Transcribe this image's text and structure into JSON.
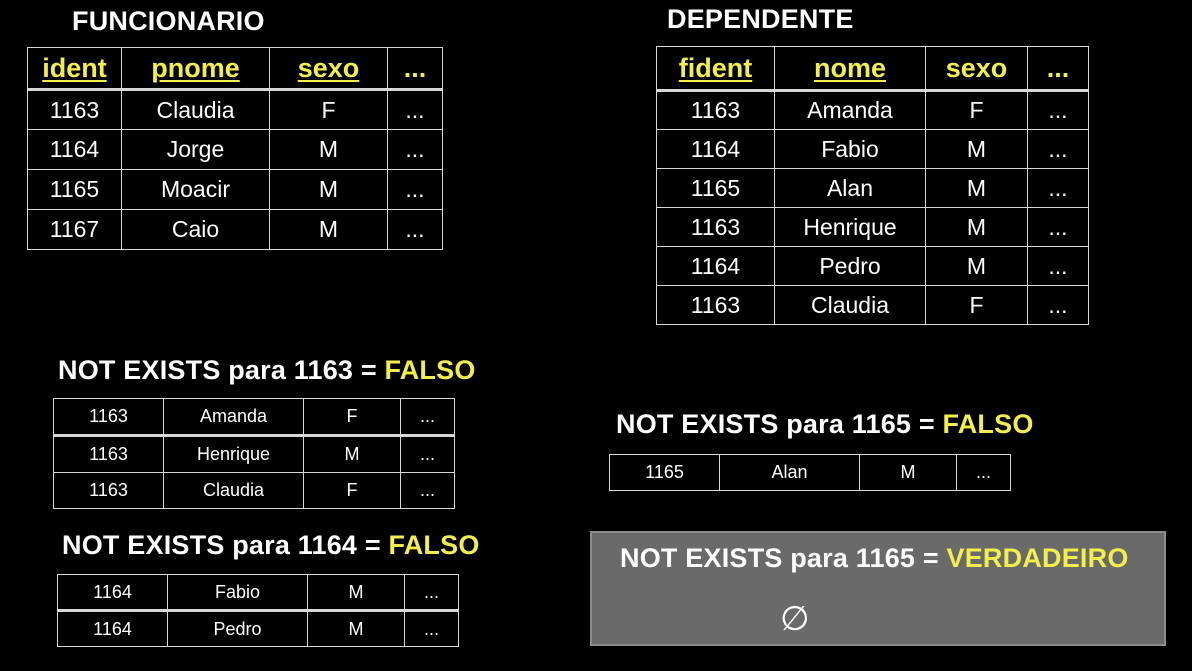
{
  "funcionario": {
    "title": "FUNCIONARIO",
    "columns": [
      "ident",
      "pnome",
      "sexo",
      "..."
    ],
    "rows": [
      [
        "1163",
        "Claudia",
        "F",
        "..."
      ],
      [
        "1164",
        "Jorge",
        "M",
        "..."
      ],
      [
        "1165",
        "Moacir",
        "M",
        "..."
      ],
      [
        "1167",
        "Caio",
        "M",
        "..."
      ]
    ]
  },
  "dependente": {
    "title": "DEPENDENTE",
    "columns": [
      "fident",
      "nome",
      "sexo",
      "..."
    ],
    "rows": [
      [
        "1163",
        "Amanda",
        "F",
        "..."
      ],
      [
        "1164",
        "Fabio",
        "M",
        "..."
      ],
      [
        "1165",
        "Alan",
        "M",
        "..."
      ],
      [
        "1163",
        "Henrique",
        "M",
        "..."
      ],
      [
        "1164",
        "Pedro",
        "M",
        "..."
      ],
      [
        "1163",
        "Claudia",
        "F",
        "..."
      ]
    ]
  },
  "check_1163": {
    "label": "NOT EXISTS para 1163 =",
    "result": "FALSO",
    "rows": [
      [
        "1163",
        "Amanda",
        "F",
        "..."
      ],
      [
        "1163",
        "Henrique",
        "M",
        "..."
      ],
      [
        "1163",
        "Claudia",
        "F",
        "..."
      ]
    ]
  },
  "check_1164": {
    "label": "NOT EXISTS para 1164 =",
    "result": "FALSO",
    "rows": [
      [
        "1164",
        "Fabio",
        "M",
        "..."
      ],
      [
        "1164",
        "Pedro",
        "M",
        "..."
      ]
    ]
  },
  "check_1165": {
    "label": "NOT EXISTS para 1165 =",
    "result": "FALSO",
    "rows": [
      [
        "1165",
        "Alan",
        "M",
        "..."
      ]
    ]
  },
  "check_final": {
    "label": "NOT EXISTS para 1165 =",
    "result": "VERDADEIRO",
    "empty_symbol": "∅"
  }
}
